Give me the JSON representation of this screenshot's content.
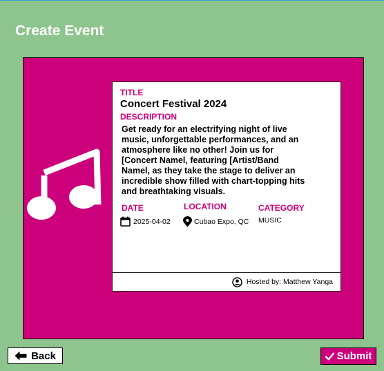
{
  "page": {
    "title": "Create Event"
  },
  "event": {
    "title_label": "TITLE",
    "title": "Concert Festival 2024",
    "description_label": "DESCRIPTION",
    "description": "Get ready for an electrifying night of live music, unforgettable performances, and an atmosphere like no other! Join us for [Concert Namel, featuring [Artist/Band Namel, as they take the stage to deliver an incredible show filled with chart-topping hits and breathtaking visuals.",
    "date_label": "DATE",
    "date": "2025-04-02",
    "location_label": "LOCATION",
    "location": "Cubao Expo, QC",
    "category_label": "CATEGORY",
    "category": "MUSIC",
    "host": "Hosted by: Matthew Yanga"
  },
  "buttons": {
    "back": "Back",
    "submit": "Submit"
  },
  "icons": {
    "event_image": "music-note-icon",
    "date": "calendar-icon",
    "location": "map-pin-icon",
    "host": "user-circle-icon",
    "back": "arrow-left-icon",
    "submit": "check-icon"
  },
  "colors": {
    "background": "#8ec48d",
    "accent": "#cc007a",
    "card": "#ffffff"
  }
}
